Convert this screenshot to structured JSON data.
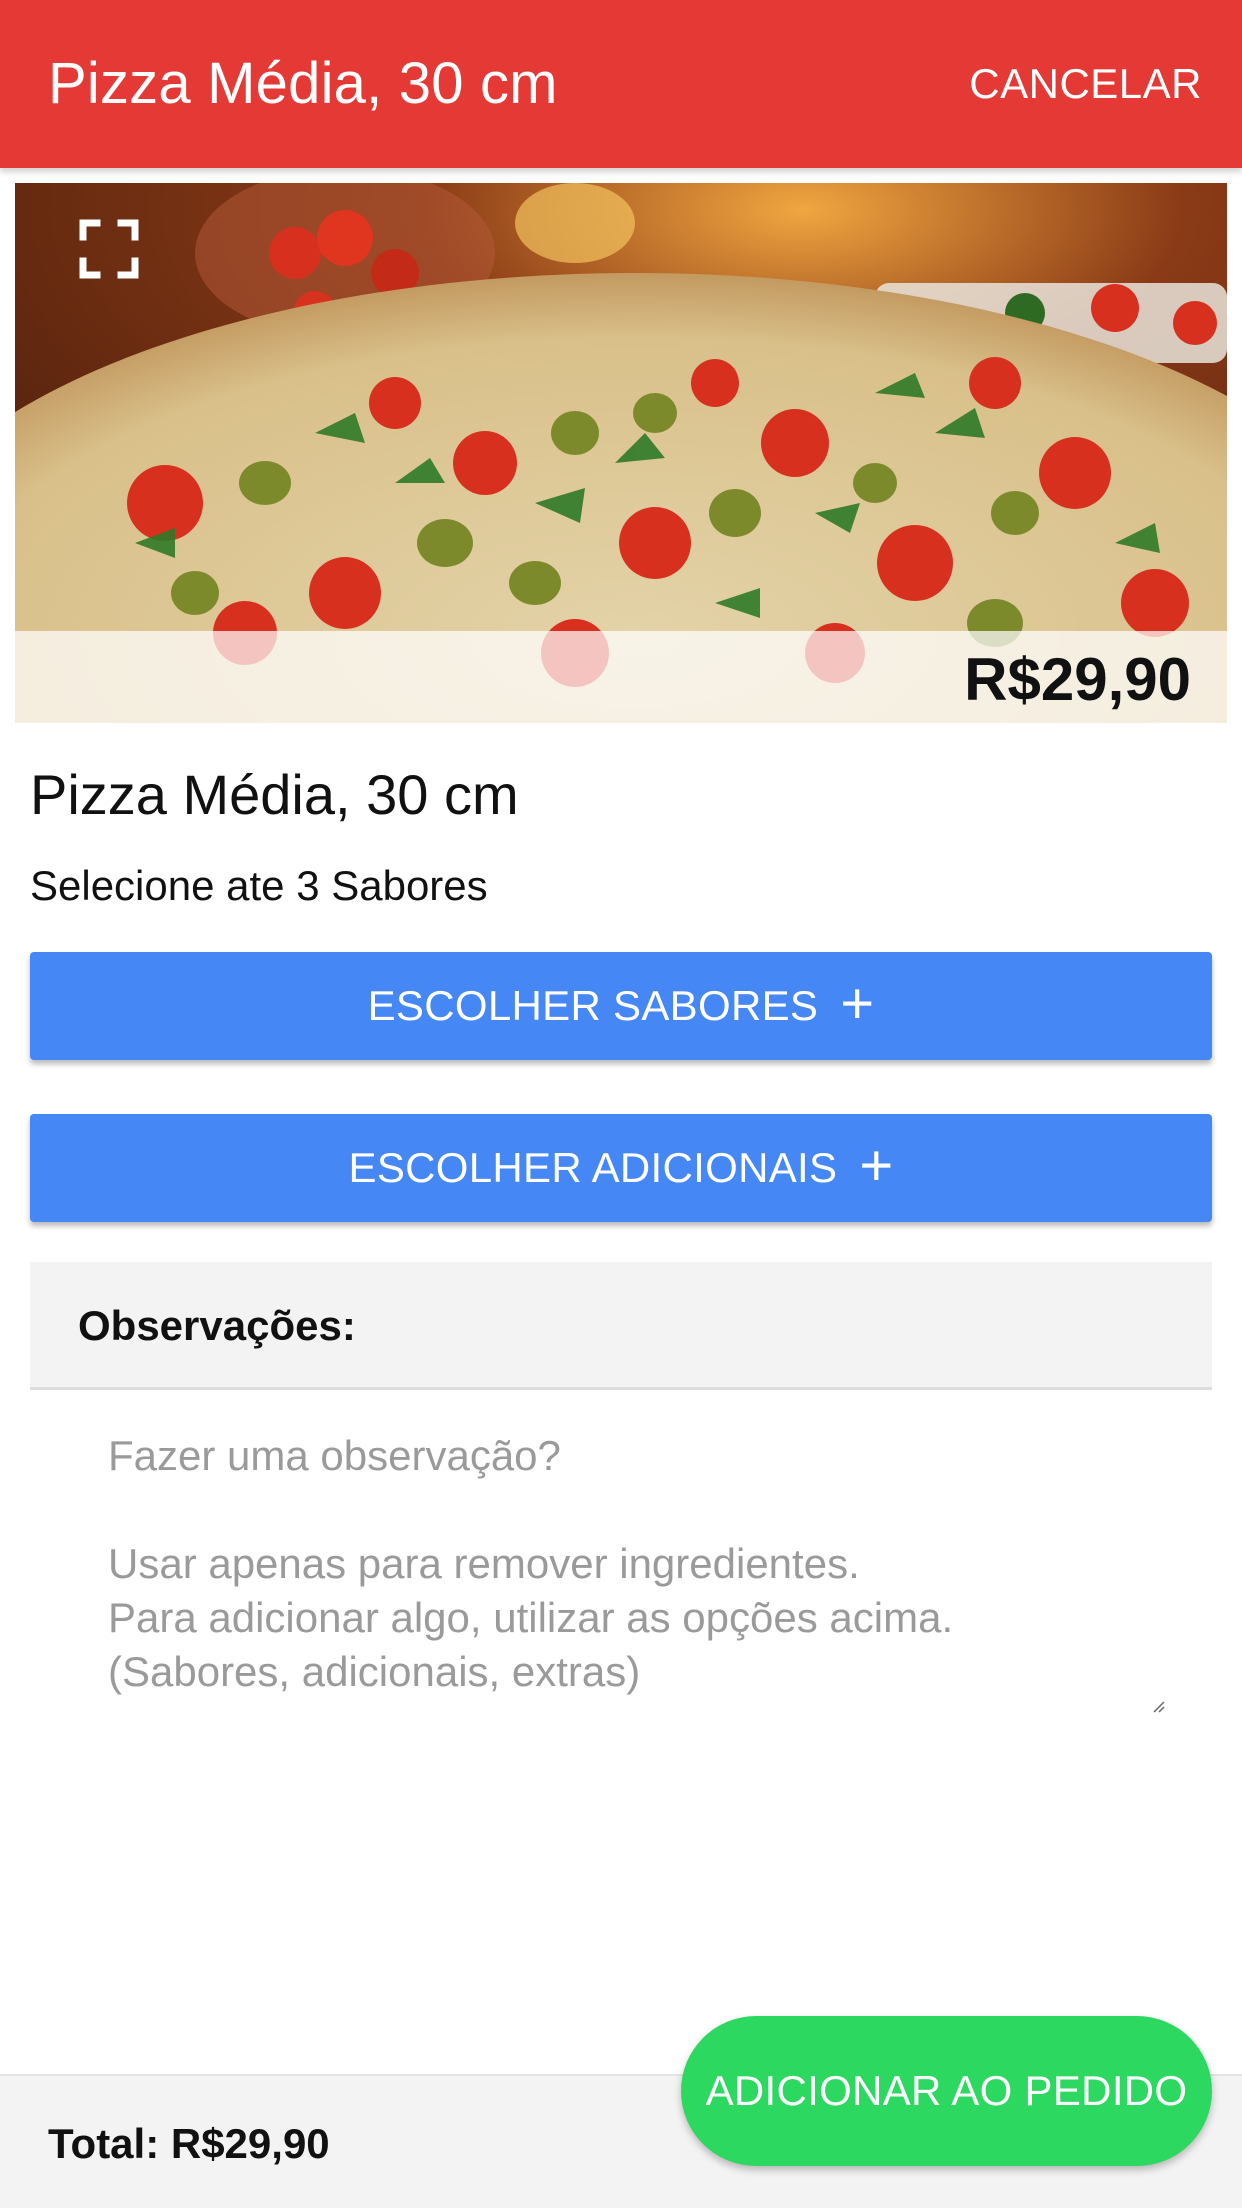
{
  "header": {
    "title": "Pizza Média, 30 cm",
    "cancel_label": "CANCELAR",
    "color": "#e53935"
  },
  "product": {
    "price": "R$29,90",
    "name": "Pizza Média, 30 cm",
    "subtitle": "Selecione ate 3 Sabores",
    "image_icon": "expand-icon"
  },
  "actions": {
    "flavors_label": "ESCOLHER SABORES",
    "addons_label": "ESCOLHER ADICIONAIS",
    "plus_icon": "plus-icon",
    "color": "#4587f5"
  },
  "notes": {
    "label": "Observações:",
    "placeholder": "Fazer uma observação?\n\nUsar apenas para remover ingredientes.\nPara adicionar algo, utilizar as opções acima.\n(Sabores, adicionais, extras)"
  },
  "footer": {
    "total": "Total: R$29,90",
    "add_to_order_label": "ADICIONAR AO PEDIDO",
    "add_color": "#2dd860"
  }
}
